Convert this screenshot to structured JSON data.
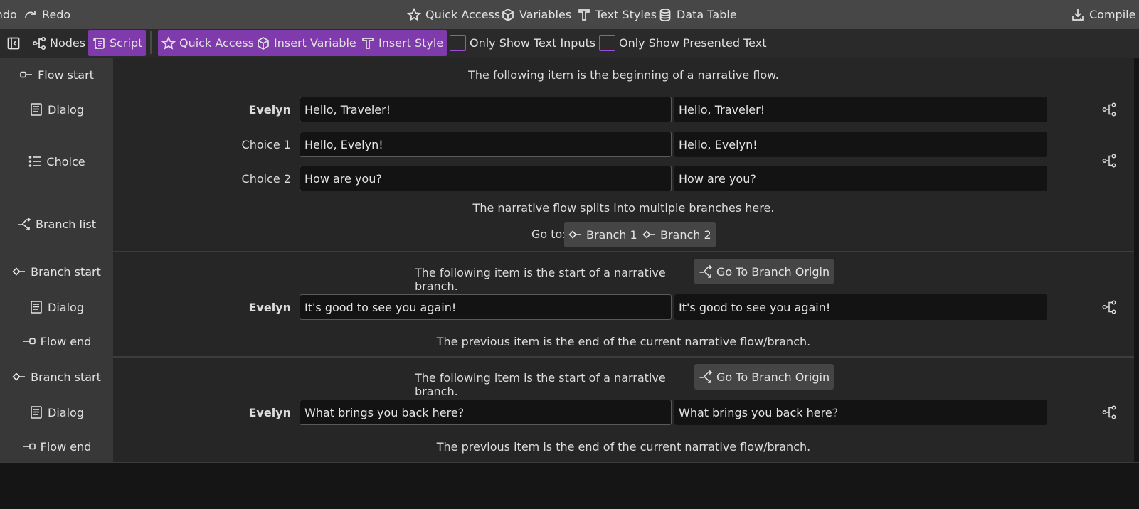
{
  "menubar": {
    "undo": "Undo",
    "redo": "Redo",
    "quick_access": "Quick Access",
    "variables": "Variables",
    "text_styles": "Text Styles",
    "data_table": "Data Table",
    "compile": "Compile"
  },
  "toolbar": {
    "nodes": "Nodes",
    "script": "Script",
    "quick_access": "Quick Access",
    "insert_variable": "Insert Variable",
    "insert_style": "Insert Style",
    "only_text_inputs": "Only Show Text Inputs",
    "only_presented_text": "Only Show Presented Text"
  },
  "sidebar": [
    {
      "label": "Flow start",
      "icon": "flow-start-icon"
    },
    {
      "label": "Dialog",
      "icon": "dialog-icon"
    },
    {
      "label": "Choice",
      "icon": "choice-icon"
    },
    {
      "label": "Branch list",
      "icon": "branch-list-icon"
    },
    {
      "label": "Branch start",
      "icon": "branch-start-icon"
    },
    {
      "label": "Dialog",
      "icon": "dialog-icon"
    },
    {
      "label": "Flow end",
      "icon": "flow-end-icon"
    },
    {
      "label": "Branch start",
      "icon": "branch-start-icon"
    },
    {
      "label": "Dialog",
      "icon": "dialog-icon"
    },
    {
      "label": "Flow end",
      "icon": "flow-end-icon"
    }
  ],
  "content": {
    "flow_start_text": "The following item is the beginning of a narrative flow.",
    "dialog1": {
      "speaker": "Evelyn",
      "input": "Hello, Traveler!",
      "output": "Hello, Traveler!"
    },
    "choice1": {
      "label": "Choice 1",
      "input": "Hello, Evelyn!",
      "output": "Hello, Evelyn!"
    },
    "choice2": {
      "label": "Choice 2",
      "input": "How are you?",
      "output": "How are you?"
    },
    "branch_list_text": "The narrative flow splits into multiple branches here.",
    "goto_label": "Go to:",
    "branch1": "Branch 1",
    "branch2": "Branch 2",
    "branch_start_text": "The following item is the start of a narrative branch.",
    "go_to_origin": "Go To Branch Origin",
    "dialog2": {
      "speaker": "Evelyn",
      "input": "It's good to see you again!",
      "output": "It's good to see you again!"
    },
    "flow_end_text": "The previous item is the end of the current narrative flow/branch.",
    "dialog3": {
      "speaker": "Evelyn",
      "input": "What brings you back here?",
      "output": "What brings you back here?"
    }
  },
  "colors": {
    "accent": "#7f3aab",
    "checkbox_border": "#9c4fd6",
    "menubar_bg": "#474747",
    "toolbar_bg": "#2a2a2a",
    "sidebar_bg": "#383838",
    "content_bg": "#262626",
    "field_bg": "#131313"
  }
}
